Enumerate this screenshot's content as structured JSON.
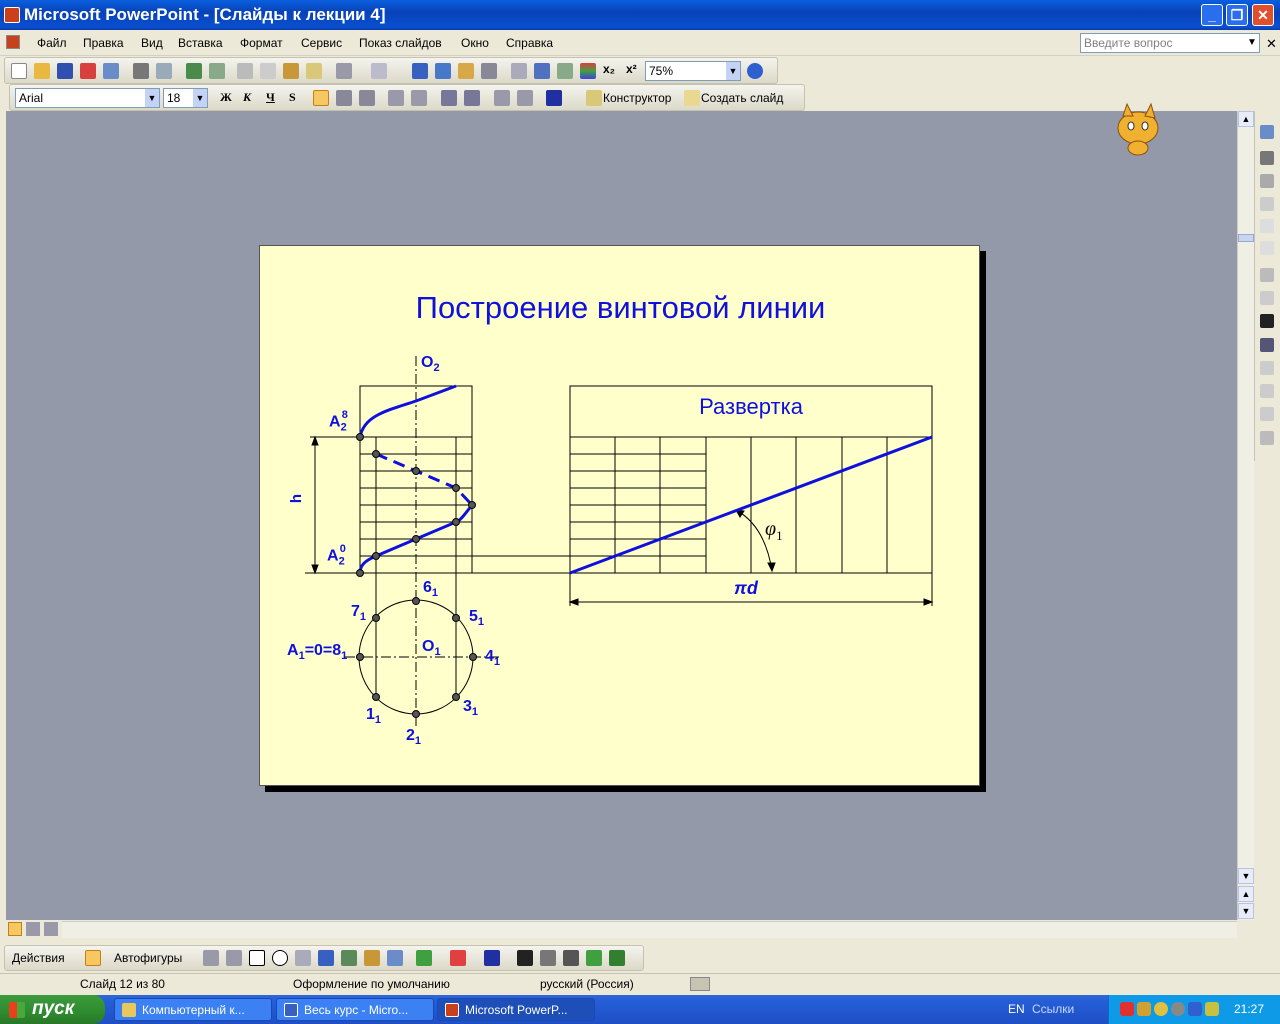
{
  "window": {
    "title": "Microsoft PowerPoint - [Слайды к лекции 4]",
    "minimize": "_",
    "restore": "❐",
    "close": "✕"
  },
  "menu": {
    "items": [
      "Файл",
      "Правка",
      "Вид",
      "Вставка",
      "Формат",
      "Сервис",
      "Показ слайдов",
      "Окно",
      "Справка"
    ],
    "ask_placeholder": "Введите вопрос"
  },
  "toolbar": {
    "zoom": "75%",
    "font": "Arial",
    "font_size": "18",
    "bold": "Ж",
    "italic": "К",
    "underline": "Ч",
    "shadow": "S",
    "designer": "Конструктор",
    "new_slide": "Создать слайд"
  },
  "slide": {
    "title": "Построение винтовой линии",
    "razvertka": "Развертка",
    "labels": {
      "o2": "O",
      "o2_sub": "2",
      "a2_8": "A",
      "a2_8_sub": "2",
      "a2_8_sup": "8",
      "a2_0": "A",
      "a2_0_sub": "2",
      "a2_0_sup": "0",
      "h": "h",
      "p6": "6",
      "p5": "5",
      "p4": "4",
      "p3": "3",
      "p2": "2",
      "p1": "1",
      "p7": "7",
      "sub1": "1",
      "o1": "O",
      "a1": "A",
      "a1_rest": "=0=8",
      "pid": "πd",
      "phi": "φ"
    }
  },
  "drawbar": {
    "actions": "Действия",
    "autoshapes": "Автофигуры"
  },
  "status": {
    "slide": "Слайд 12 из 80",
    "design": "Оформление по умолчанию",
    "language": "русский (Россия)"
  },
  "taskbar": {
    "start": "пуск",
    "tasks": [
      "Компьютерный к...",
      "Весь курс - Micro...",
      "Microsoft PowerP..."
    ],
    "lang": "EN",
    "links": "Ссылки",
    "clock": "21:27"
  },
  "colors": {
    "slide_bg": "#ffffcc",
    "accent": "#1010dd",
    "workspace": "#9499a9"
  }
}
